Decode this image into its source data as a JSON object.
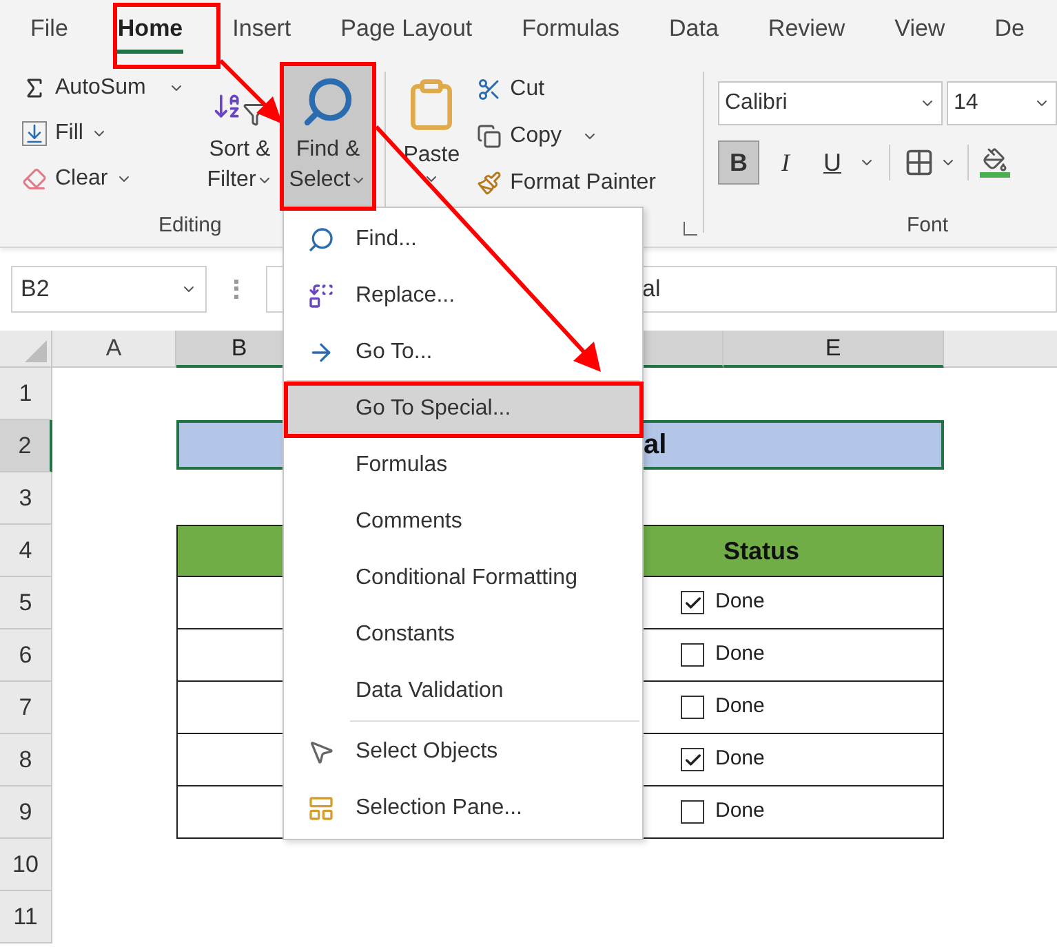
{
  "tabs": [
    {
      "label": "File",
      "selected": false
    },
    {
      "label": "Home",
      "selected": true
    },
    {
      "label": "Insert",
      "selected": false
    },
    {
      "label": "Page Layout",
      "selected": false
    },
    {
      "label": "Formulas",
      "selected": false
    },
    {
      "label": "Data",
      "selected": false
    },
    {
      "label": "Review",
      "selected": false
    },
    {
      "label": "View",
      "selected": false
    },
    {
      "label": "De",
      "selected": false
    }
  ],
  "editing": {
    "autosum": "AutoSum",
    "fill": "Fill",
    "clear": "Clear",
    "sort": [
      "Sort &",
      "Filter"
    ],
    "find_select": {
      "lines": [
        "Find &",
        "Select"
      ],
      "pressed": true
    },
    "label": "Editing"
  },
  "clipboard": {
    "paste": "Paste",
    "cut": "Cut",
    "copy": "Copy",
    "format_painter": "Format Painter"
  },
  "font": {
    "name": "Calibri",
    "size": "14",
    "bold": {
      "label": "B",
      "on": true
    },
    "italic": {
      "label": "I",
      "on": false
    },
    "underline": {
      "label": "U",
      "on": false
    },
    "label": "Font"
  },
  "formula_bar": {
    "name_box": "B2",
    "formula": "al"
  },
  "sheet": {
    "columns": [
      {
        "label": "A",
        "selected": false
      },
      {
        "label": "B",
        "selected": true
      },
      {
        "label": "E",
        "selected": true
      }
    ],
    "rows": [
      {
        "label": "1",
        "selected": false,
        "kind": "blank"
      },
      {
        "label": "2",
        "selected": true,
        "kind": "title",
        "text": "al"
      },
      {
        "label": "3",
        "selected": false,
        "kind": "blank"
      },
      {
        "label": "4",
        "selected": false,
        "kind": "header",
        "text": "Status"
      },
      {
        "label": "5",
        "selected": false,
        "kind": "item",
        "checked": true,
        "text": "Done"
      },
      {
        "label": "6",
        "selected": false,
        "kind": "item",
        "checked": false,
        "text": "Done"
      },
      {
        "label": "7",
        "selected": false,
        "kind": "item",
        "checked": false,
        "text": "Done"
      },
      {
        "label": "8",
        "selected": false,
        "kind": "item",
        "checked": true,
        "text": "Done"
      },
      {
        "label": "9",
        "selected": false,
        "kind": "item",
        "checked": false,
        "text": "Done"
      },
      {
        "label": "10",
        "selected": false,
        "kind": "blank"
      },
      {
        "label": "11",
        "selected": false,
        "kind": "blank"
      }
    ]
  },
  "menu": {
    "items": [
      {
        "label": "Find...",
        "kind": "find",
        "selected": false,
        "separator_before": false
      },
      {
        "label": "Replace...",
        "kind": "replace",
        "selected": false,
        "separator_before": false
      },
      {
        "label": "Go To...",
        "kind": "goto",
        "selected": false,
        "separator_before": false
      },
      {
        "label": "Go To Special...",
        "kind": "plain",
        "selected": true,
        "separator_before": false
      },
      {
        "label": "Formulas",
        "kind": "plain",
        "selected": false,
        "separator_before": false
      },
      {
        "label": "Comments",
        "kind": "plain",
        "selected": false,
        "separator_before": false
      },
      {
        "label": "Conditional Formatting",
        "kind": "plain",
        "selected": false,
        "separator_before": false
      },
      {
        "label": "Constants",
        "kind": "plain",
        "selected": false,
        "separator_before": false
      },
      {
        "label": "Data Validation",
        "kind": "plain",
        "selected": false,
        "separator_before": false
      },
      {
        "label": "Select Objects",
        "kind": "select",
        "selected": false,
        "separator_before": true
      },
      {
        "label": "Selection Pane...",
        "kind": "pane",
        "selected": false,
        "separator_before": false
      }
    ]
  }
}
